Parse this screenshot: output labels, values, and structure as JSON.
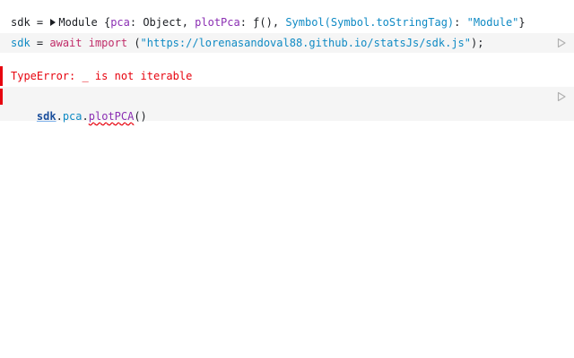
{
  "colors": {
    "error": "#e7040f",
    "cell_bg": "#f5f5f5",
    "string": "#0f8ac4",
    "keyword": "#c02c68",
    "property": "#8b2fb3"
  },
  "cell1": {
    "output": {
      "var_name": "sdk",
      "eq": " = ",
      "type_label": "Module",
      "open_brace": " {",
      "key_pca": "pca",
      "colon1": ": ",
      "val_pca": "Object",
      "comma1": ", ",
      "key_plot": "plotPca",
      "colon2": ": ",
      "val_plot": "ƒ()",
      "comma2": ", ",
      "key_symbol": "Symbol(Symbol.toStringTag)",
      "colon3": ": ",
      "val_symbol": "\"Module\"",
      "close_brace": "}"
    },
    "input": {
      "var_name": "sdk",
      "eq": " = ",
      "kw_await": "await",
      "space": " ",
      "kw_import": "import",
      "open_paren": " (",
      "url": "\"https://lorenasandoval88.github.io/statsJs/sdk.js\"",
      "close_paren": ");"
    },
    "run_icon": "play-icon"
  },
  "cell2": {
    "error": "TypeError: _ is not iterable",
    "input": {
      "obj": "sdk",
      "dot1": ".",
      "prop": "pca",
      "dot2": ".",
      "method": "plotPCA",
      "call": "()"
    },
    "run_icon": "play-icon"
  }
}
